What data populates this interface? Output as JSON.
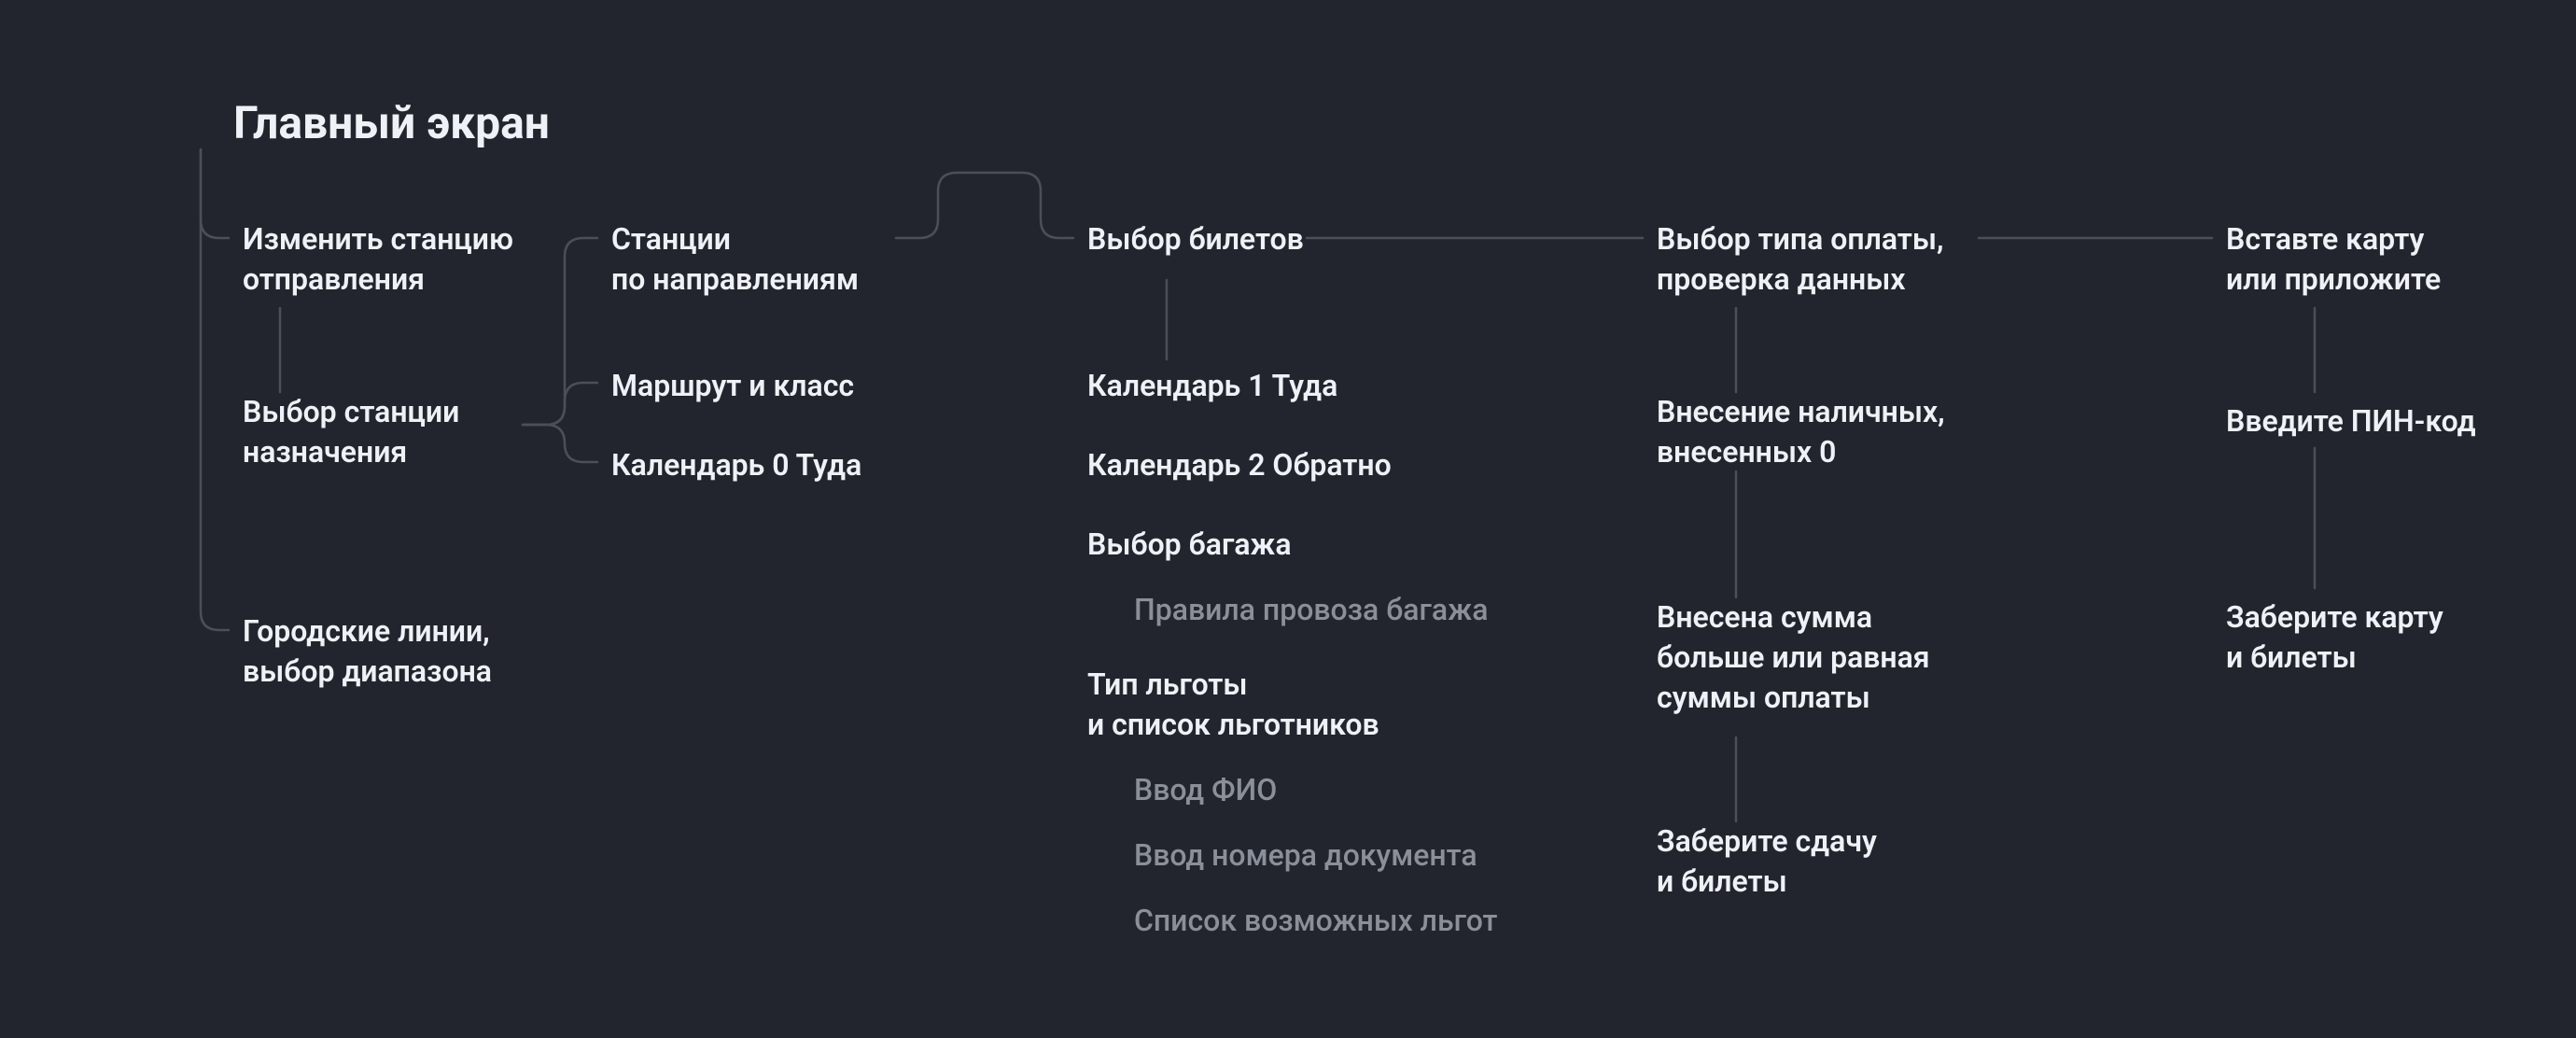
{
  "title": "Главный экран",
  "nodes": {
    "change_station": "Изменить станцию\nотправления",
    "dest_station": "Выбор станции\nназначения",
    "city_lines": "Городские линии,\nвыбор диапазона",
    "stations_dir": "Станции\nпо направлениям",
    "route_class": "Маршрут и класс",
    "calendar0": "Календарь 0 Туда",
    "tickets": "Выбор билетов",
    "calendar1": "Календарь 1 Туда",
    "calendar2": "Календарь 2 Обратно",
    "baggage": "Выбор багажа",
    "baggage_rules": "Правила провоза багажа",
    "benefit_type": "Тип льготы\nи список льготников",
    "fio": "Ввод ФИО",
    "doc_number": "Ввод номера документа",
    "benefits_list": "Список возможных льгот",
    "payment_type": "Выбор типа оплаты,\nпроверка данных",
    "cash_in": "Внесение наличных,\nвнесенных 0",
    "sum_enough": "Внесена сумма\nбольше или равная\nсуммы оплаты",
    "take_change": "Заберите сдачу\nи билеты",
    "insert_card": "Вставте карту\nили приложите",
    "enter_pin": "Введите ПИН-код",
    "take_card": "Заберите карту\nи билеты"
  }
}
